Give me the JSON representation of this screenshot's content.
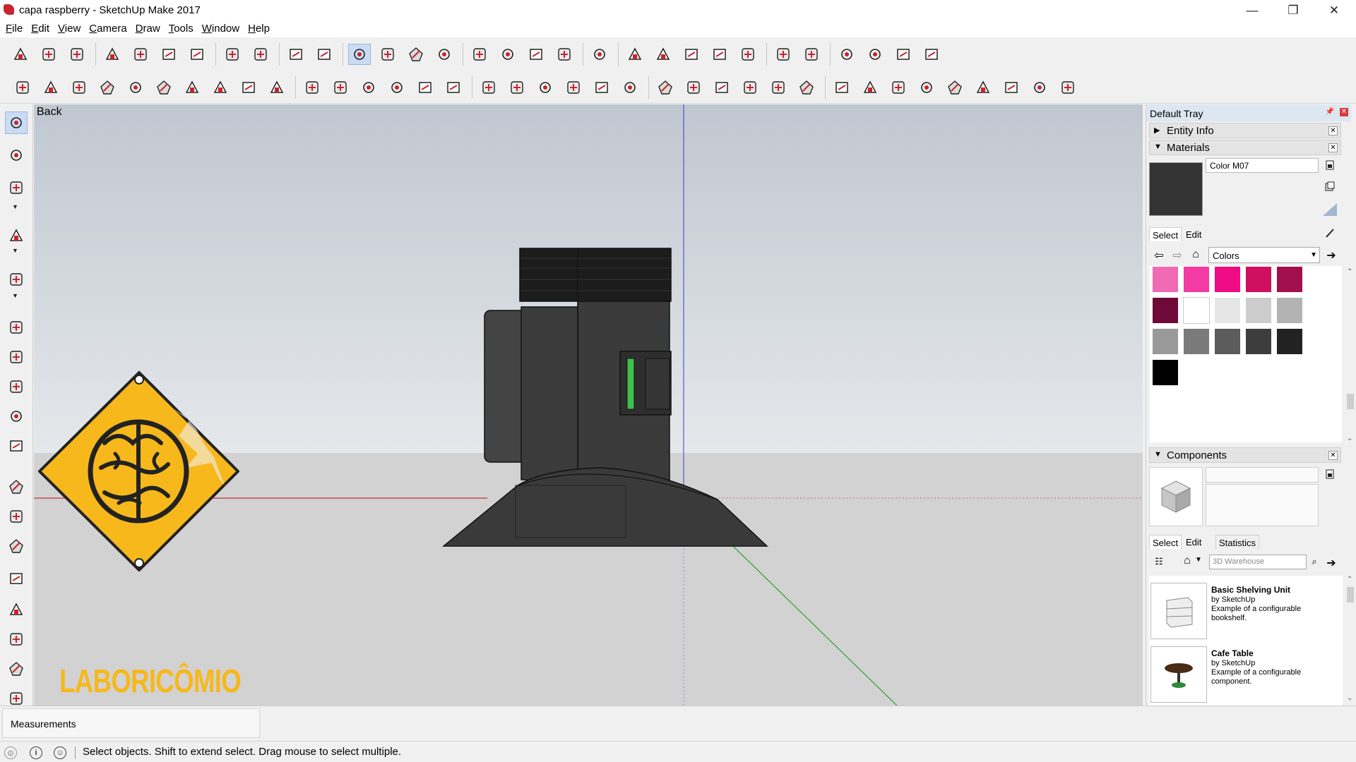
{
  "window": {
    "title": "capa raspberry - SketchUp Make 2017",
    "minimize_glyph": "—",
    "restore_glyph": "❐",
    "close_glyph": "✕"
  },
  "menu": [
    "File",
    "Edit",
    "View",
    "Camera",
    "Draw",
    "Tools",
    "Window",
    "Help"
  ],
  "toolbar_row1": [
    "new-icon",
    "open-icon",
    "save-icon",
    "cut-icon",
    "copy-icon",
    "paste-icon",
    "erase-icon",
    "undo-icon",
    "redo-icon",
    "print-icon",
    "model-info-icon",
    "select-icon",
    "make-component-icon",
    "paint-bucket-icon",
    "eraser-icon",
    "warehouse-icon",
    "share-model-icon",
    "share-component-icon",
    "extension-warehouse-icon",
    "layout-icon",
    "iso-view-icon",
    "top-view-icon",
    "front-view-icon",
    "right-view-icon",
    "back-view-icon",
    "xray-icon",
    "wireframe-icon",
    "hidden-line-icon",
    "shaded-icon",
    "shaded-textures-icon",
    "monochrome-icon"
  ],
  "toolbar_row2": [
    "line-icon",
    "freehand-icon",
    "rectangle-icon",
    "rotated-rectangle-icon",
    "circle-icon",
    "polygon-icon",
    "arc-icon",
    "two-point-arc-icon",
    "three-point-arc-icon",
    "pie-icon",
    "iso-house-icon",
    "top-house-icon",
    "front-house-icon",
    "right-house-icon",
    "back-house-icon",
    "left-house-icon",
    "move-icon",
    "push-pull-icon",
    "rotate-icon",
    "follow-me-icon",
    "scale-icon",
    "offset-icon",
    "tape-measure-icon",
    "dimension-icon",
    "protractor-icon",
    "text-icon",
    "axes-icon",
    "3d-text-icon",
    "orbit-icon",
    "pan-icon",
    "zoom-icon",
    "zoom-window-icon",
    "zoom-extents-icon",
    "previous-view-icon",
    "position-camera-icon",
    "look-around-icon",
    "walk-icon"
  ],
  "left_toolbar": [
    "select-icon",
    "eraser-icon",
    "line-icon",
    "arc-icon",
    "rectangle-icon",
    "push-pull-icon",
    "follow-me-icon",
    "move-icon",
    "rotate-icon",
    "scale-icon",
    "tape-measure-icon",
    "text-icon",
    "paint-bucket-icon",
    "orbit-icon",
    "pan-icon",
    "zoom-icon",
    "zoom-extents-icon",
    "warehouse-icon"
  ],
  "viewport": {
    "scene_label": "Back",
    "logo_text": "LABORICÔMIO"
  },
  "measurements": {
    "label": "Measurements"
  },
  "status": {
    "text": "Select objects. Shift to extend select. Drag mouse to select multiple."
  },
  "tray": {
    "title": "Default Tray",
    "entity_info": {
      "title": "Entity Info"
    },
    "materials": {
      "title": "Materials",
      "current_name": "Color M07",
      "tab_select": "Select",
      "tab_edit": "Edit",
      "collection": "Colors",
      "swatches": [
        "#f06ab4",
        "#f43aa4",
        "#ef0b84",
        "#cf1060",
        "#a20f4c",
        "#6e0a37",
        "#ffffff",
        "#e6e6e6",
        "#cccccc",
        "#b3b3b3",
        "#999999",
        "#7a7a7a",
        "#5c5c5c",
        "#3d3d3d",
        "#222222",
        "#000000"
      ]
    },
    "components": {
      "title": "Components",
      "tab_select": "Select",
      "tab_edit": "Edit",
      "tab_statistics": "Statistics",
      "search_placeholder": "3D Warehouse",
      "items": [
        {
          "title": "Basic Shelving Unit",
          "by": "by SketchUp",
          "desc": "Example of a configurable bookshelf."
        },
        {
          "title": "Cafe Table",
          "by": "by SketchUp",
          "desc": "Example of a configurable component."
        }
      ]
    }
  },
  "colors": {
    "accent_red": "#c8242b",
    "selection_blue": "#c9dcf3",
    "logo_yellow": "#f7b81c"
  }
}
